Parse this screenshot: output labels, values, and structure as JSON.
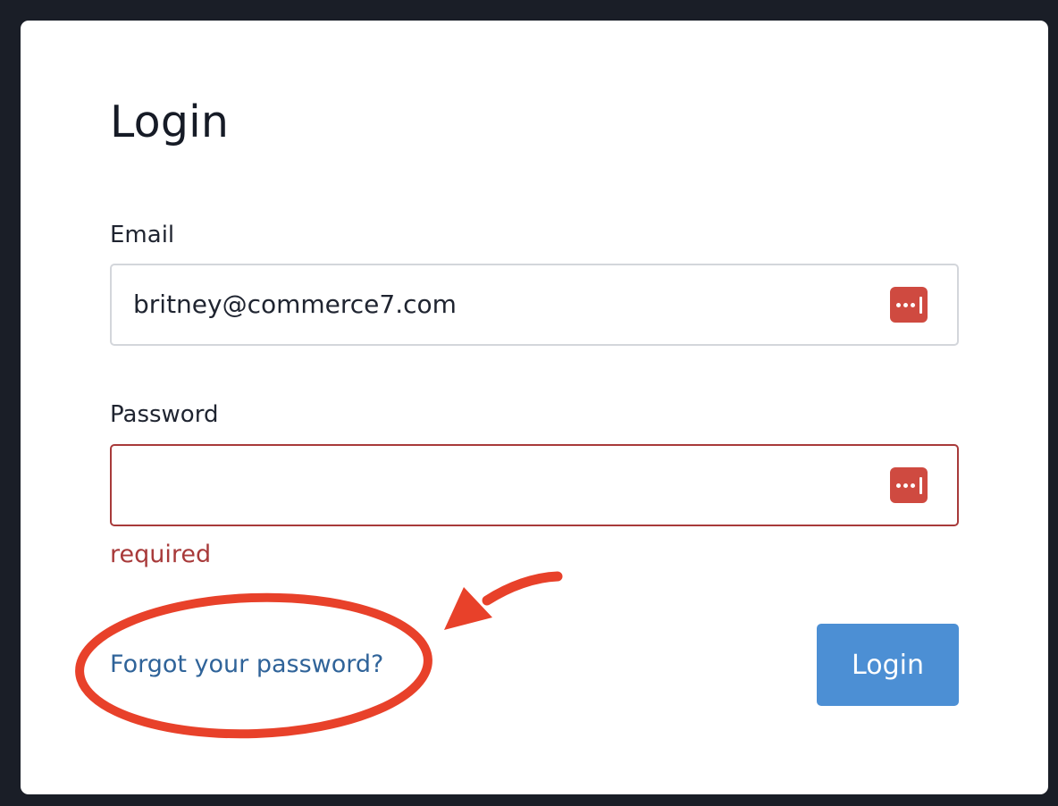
{
  "form": {
    "title": "Login",
    "email_label": "Email",
    "email_value": "britney@commerce7.com",
    "password_label": "Password",
    "password_value": "",
    "password_error": "required",
    "forgot_link": "Forgot your password?",
    "login_button": "Login"
  },
  "icons": {
    "field_icon": "password-manager-icon",
    "annotation": "red-circle-and-arrow"
  },
  "colors": {
    "background": "#1a1e27",
    "card": "#ffffff",
    "button": "#4c8fd4",
    "link": "#2f6399",
    "error": "#a83a3a",
    "password_manager_icon": "#cf4a40",
    "annotation": "#e8412a"
  }
}
